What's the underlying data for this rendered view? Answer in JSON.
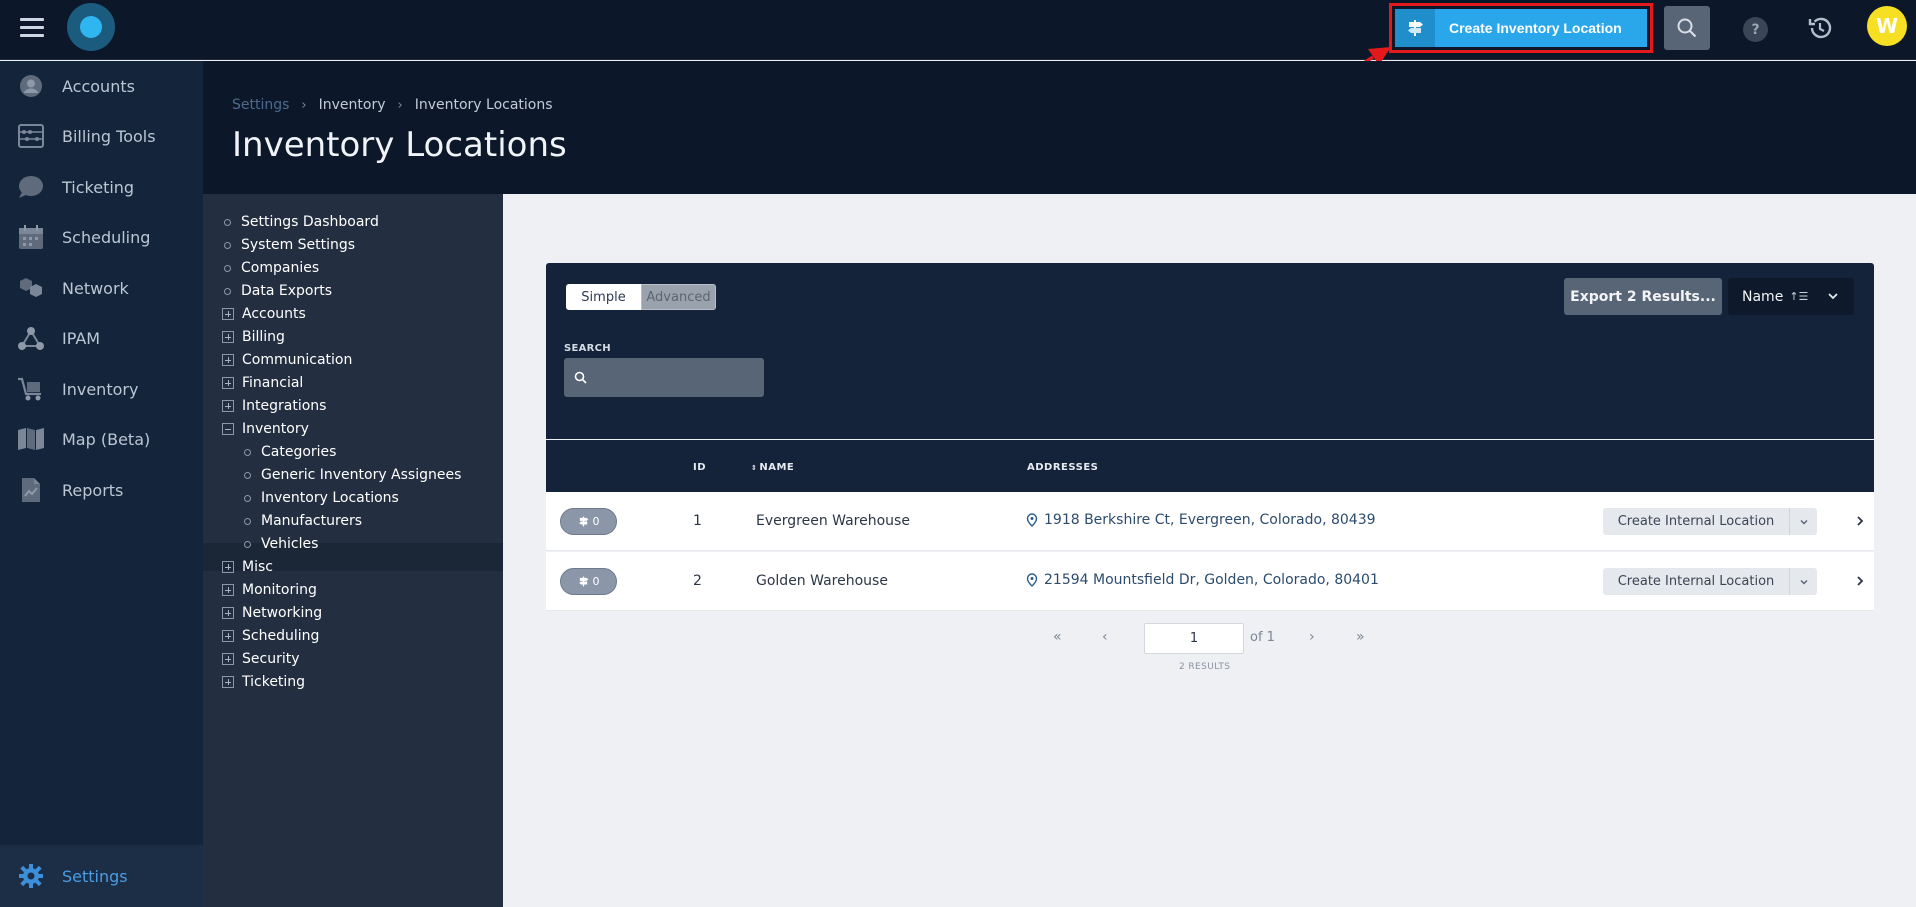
{
  "topbar": {
    "create_button_label": "Create Inventory Location",
    "avatar_initial": "W",
    "help_label": "?"
  },
  "nav": {
    "items": [
      {
        "label": "Accounts",
        "icon": "user-circle-icon"
      },
      {
        "label": "Billing Tools",
        "icon": "abacus-icon"
      },
      {
        "label": "Ticketing",
        "icon": "chat-bubble-icon"
      },
      {
        "label": "Scheduling",
        "icon": "calendar-icon"
      },
      {
        "label": "Network",
        "icon": "network-icon"
      },
      {
        "label": "IPAM",
        "icon": "nodes-icon"
      },
      {
        "label": "Inventory",
        "icon": "cart-icon"
      },
      {
        "label": "Map (Beta)",
        "icon": "map-icon"
      },
      {
        "label": "Reports",
        "icon": "report-icon"
      }
    ],
    "settings_label": "Settings"
  },
  "breadcrumb": {
    "items": [
      "Settings",
      "Inventory",
      "Inventory Locations"
    ]
  },
  "page": {
    "title": "Inventory Locations"
  },
  "settings_nav": {
    "items": [
      {
        "label": "Settings Dashboard",
        "marker": "dot",
        "level": 0
      },
      {
        "label": "System Settings",
        "marker": "dot",
        "level": 0
      },
      {
        "label": "Companies",
        "marker": "dot",
        "level": 0
      },
      {
        "label": "Data Exports",
        "marker": "dot",
        "level": 0
      },
      {
        "label": "Accounts",
        "marker": "plus",
        "level": 0
      },
      {
        "label": "Billing",
        "marker": "plus",
        "level": 0
      },
      {
        "label": "Communication",
        "marker": "plus",
        "level": 0
      },
      {
        "label": "Financial",
        "marker": "plus",
        "level": 0
      },
      {
        "label": "Integrations",
        "marker": "plus",
        "level": 0
      },
      {
        "label": "Inventory",
        "marker": "minus",
        "level": 0
      },
      {
        "label": "Categories",
        "marker": "dot",
        "level": 1
      },
      {
        "label": "Generic Inventory Assignees",
        "marker": "dot",
        "level": 1
      },
      {
        "label": "Inventory Locations",
        "marker": "dot",
        "level": 1,
        "active": true
      },
      {
        "label": "Manufacturers",
        "marker": "dot",
        "level": 1
      },
      {
        "label": "Vehicles",
        "marker": "dot",
        "level": 1
      },
      {
        "label": "Misc",
        "marker": "plus",
        "level": 0
      },
      {
        "label": "Monitoring",
        "marker": "plus",
        "level": 0
      },
      {
        "label": "Networking",
        "marker": "plus",
        "level": 0
      },
      {
        "label": "Scheduling",
        "marker": "plus",
        "level": 0
      },
      {
        "label": "Security",
        "marker": "plus",
        "level": 0
      },
      {
        "label": "Ticketing",
        "marker": "plus",
        "level": 0
      }
    ]
  },
  "filters": {
    "simple_label": "Simple",
    "advanced_label": "Advanced",
    "export_label": "Export 2 Results...",
    "sort_label": "Name",
    "search_label": "SEARCH",
    "search_value": ""
  },
  "table": {
    "columns": [
      "ID",
      "NAME",
      "ADDRESSES"
    ],
    "rows": [
      {
        "count": "0",
        "id": "1",
        "name": "Evergreen Warehouse",
        "address": "1918 Berkshire Ct, Evergreen, Colorado, 80439",
        "action": "Create Internal Location"
      },
      {
        "count": "0",
        "id": "2",
        "name": "Golden Warehouse",
        "address": "21594 Mountsfield Dr, Golden, Colorado, 80401",
        "action": "Create Internal Location"
      }
    ]
  },
  "pagination": {
    "page_value": "1",
    "of_label": "of 1",
    "results_label": "2 RESULTS",
    "first": "«",
    "prev": "‹",
    "next": "›",
    "last": "»"
  },
  "colors": {
    "accent": "#29a7ea",
    "annotation": "#e4191b",
    "dark_bg": "#0c1829",
    "sidebar_bg": "#232f40"
  }
}
